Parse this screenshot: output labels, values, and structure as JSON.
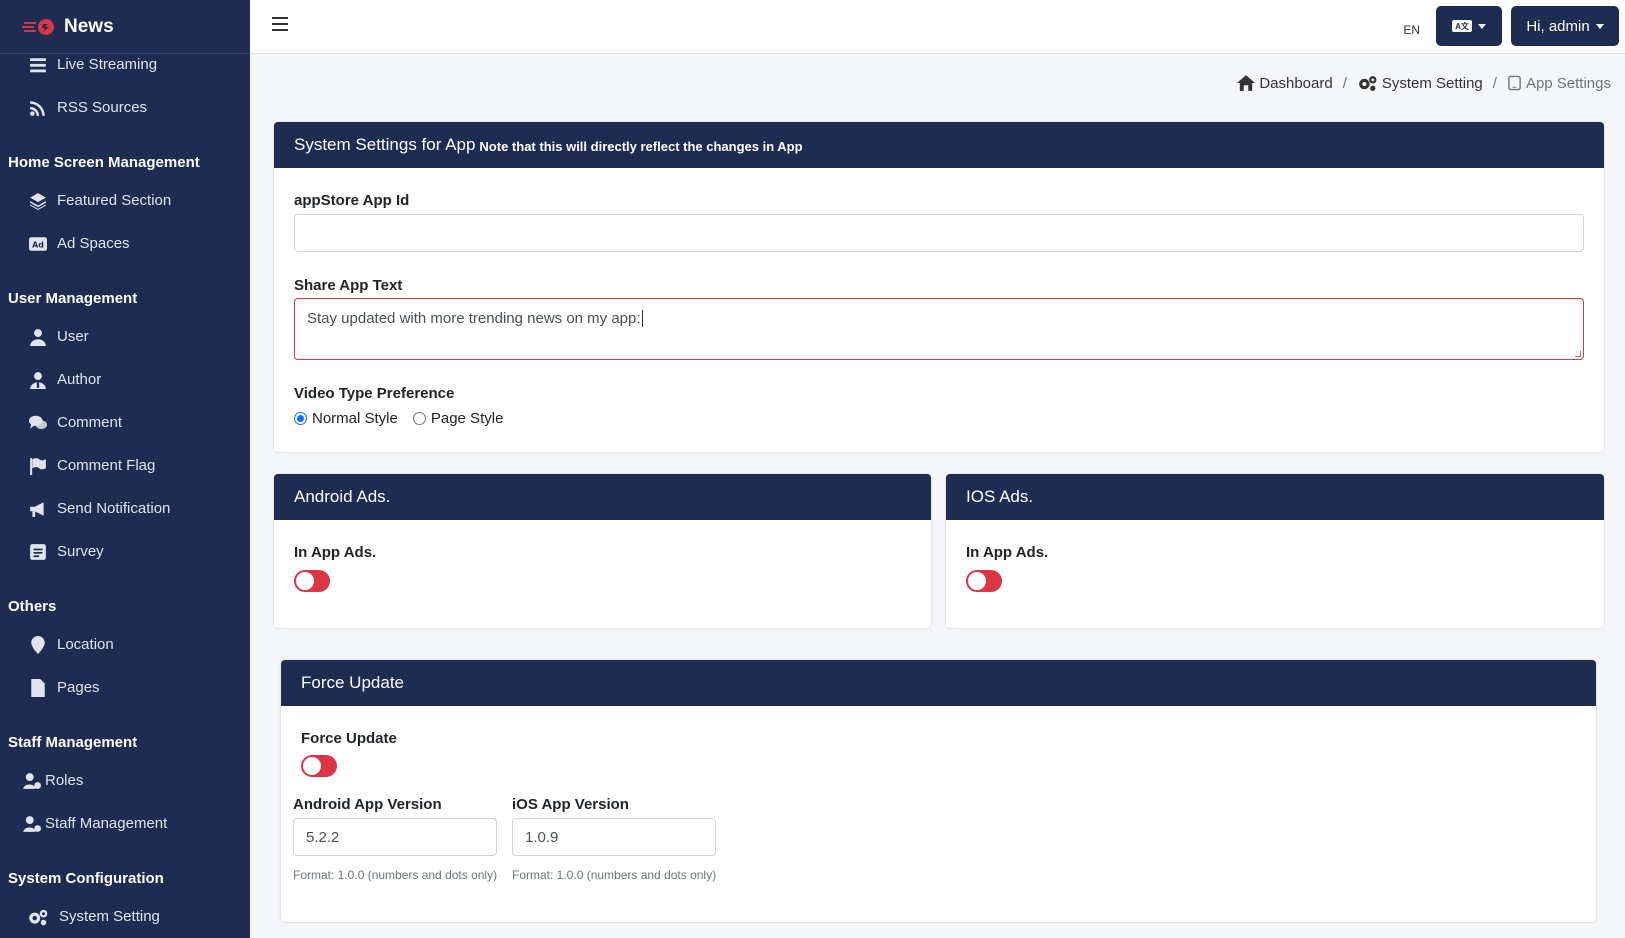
{
  "brand": {
    "title": "News",
    "color": "#1e2c52",
    "accent": "#dc3545"
  },
  "sidebar": {
    "items_top": [
      {
        "label": "Live Streaming",
        "icon": "list-icon"
      },
      {
        "label": "RSS Sources",
        "icon": "rss-icon"
      }
    ],
    "section_home": "Home Screen Management",
    "items_home": [
      {
        "label": "Featured Section",
        "icon": "layers-icon"
      },
      {
        "label": "Ad Spaces",
        "icon": "ad-icon"
      }
    ],
    "section_user": "User Management",
    "items_user": [
      {
        "label": "User",
        "icon": "user-icon"
      },
      {
        "label": "Author",
        "icon": "author-icon"
      },
      {
        "label": "Comment",
        "icon": "comments-icon"
      },
      {
        "label": "Comment Flag",
        "icon": "flag-icon"
      },
      {
        "label": "Send Notification",
        "icon": "megaphone-icon"
      },
      {
        "label": "Survey",
        "icon": "survey-icon"
      }
    ],
    "section_others": "Others",
    "items_others": [
      {
        "label": "Location",
        "icon": "location-icon"
      },
      {
        "label": "Pages",
        "icon": "file-icon"
      }
    ],
    "section_staff": "Staff Management",
    "items_staff": [
      {
        "label": "Roles",
        "icon": "user-gear-icon"
      },
      {
        "label": "Staff Management",
        "icon": "user-gear-icon"
      }
    ],
    "section_system": "System Configuration",
    "items_system": [
      {
        "label": "System Setting",
        "icon": "gears-icon"
      }
    ]
  },
  "topbar": {
    "lang_code": "EN",
    "lang_button_icon": "translate-icon",
    "user_button": "Hi, admin"
  },
  "breadcrumb": {
    "dashboard": "Dashboard",
    "system_setting": "System Setting",
    "app_settings": "App Settings",
    "separator": "/"
  },
  "settings_card": {
    "title": "System Settings for App",
    "note": "Note that this will directly reflect the changes in App",
    "appstore_label": "appStore App Id",
    "appstore_value": "",
    "share_label": "Share App Text",
    "share_value": "Stay updated with more trending news on my app:",
    "video_label": "Video Type Preference",
    "video_options": [
      "Normal Style",
      "Page Style"
    ],
    "video_selected": "Normal Style"
  },
  "android_card": {
    "title": "Android Ads.",
    "toggle_label": "In App Ads.",
    "enabled": false
  },
  "ios_card": {
    "title": "IOS Ads.",
    "toggle_label": "In App Ads.",
    "enabled": false
  },
  "force_card": {
    "title": "Force Update",
    "toggle_label": "Force Update",
    "enabled": false,
    "android_label": "Android App Version",
    "android_value": "5.2.2",
    "ios_label": "iOS App Version",
    "ios_value": "1.0.9",
    "help_text": "Format: 1.0.0 (numbers and dots only)"
  }
}
